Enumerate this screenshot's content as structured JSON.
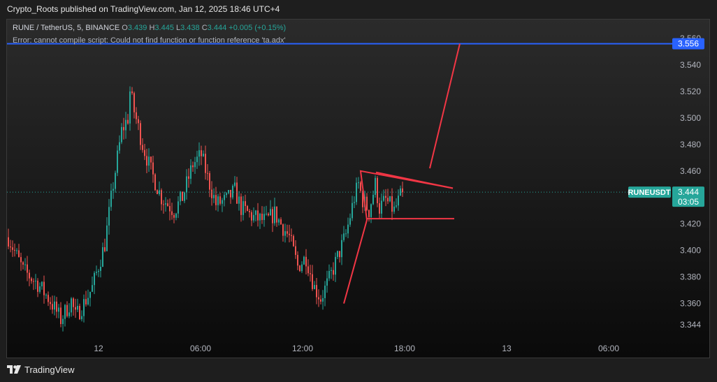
{
  "header": {
    "published": "Crypto_Roots published on TradingView.com, Jan 12, 2025 18:46 UTC+4"
  },
  "legend": {
    "symbol": "RUNE / TetherUS, 5, BINANCE",
    "o_label": "O",
    "o": "3.439",
    "h_label": "H",
    "h": "3.445",
    "l_label": "L",
    "l": "3.438",
    "c_label": "C",
    "c": "3.444",
    "change": "+0.005 (+0.15%)"
  },
  "error": "Error: cannot compile script: Could not find function or function reference 'ta.adx'",
  "badges": {
    "top_price": "3.556",
    "ticker": "RUNEUSDT",
    "price": "3.444",
    "countdown": "03:05"
  },
  "footer": {
    "brand": "TradingView",
    "logo_icon": "tradingview-logo-icon"
  },
  "colors": {
    "up": "#26a69a",
    "down": "#ef5350",
    "level_line": "#2962ff",
    "drawing": "#f23645",
    "badge": "#26a69a"
  },
  "chart_data": {
    "type": "candlestick",
    "y_ticks": [
      "3.560",
      "3.540",
      "3.520",
      "3.500",
      "3.480",
      "3.460",
      "3.420",
      "3.400",
      "3.380",
      "3.360",
      "3.344"
    ],
    "x_ticks": [
      "12",
      "06:00",
      "12:00",
      "18:00",
      "13",
      "06:00"
    ],
    "ylim": [
      3.335,
      3.562
    ],
    "levels": {
      "horizontal_line": 3.556,
      "last_price": 3.444
    },
    "price_path": [
      {
        "t": 0,
        "p": 3.41
      },
      {
        "t": 7,
        "p": 3.385
      },
      {
        "t": 14,
        "p": 3.375
      },
      {
        "t": 20,
        "p": 3.362
      },
      {
        "t": 25,
        "p": 3.348
      },
      {
        "t": 30,
        "p": 3.362
      },
      {
        "t": 32,
        "p": 3.35
      },
      {
        "t": 36,
        "p": 3.36
      },
      {
        "t": 40,
        "p": 3.372
      },
      {
        "t": 46,
        "p": 3.405
      },
      {
        "t": 50,
        "p": 3.45
      },
      {
        "t": 54,
        "p": 3.49
      },
      {
        "t": 57,
        "p": 3.5
      },
      {
        "t": 58,
        "p": 3.52
      },
      {
        "t": 60,
        "p": 3.505
      },
      {
        "t": 64,
        "p": 3.48
      },
      {
        "t": 68,
        "p": 3.46
      },
      {
        "t": 73,
        "p": 3.44
      },
      {
        "t": 79,
        "p": 3.43
      },
      {
        "t": 83,
        "p": 3.44
      },
      {
        "t": 88,
        "p": 3.465
      },
      {
        "t": 92,
        "p": 3.472
      },
      {
        "t": 95,
        "p": 3.455
      },
      {
        "t": 99,
        "p": 3.435
      },
      {
        "t": 104,
        "p": 3.438
      },
      {
        "t": 108,
        "p": 3.445
      },
      {
        "t": 111,
        "p": 3.432
      },
      {
        "t": 117,
        "p": 3.425
      },
      {
        "t": 123,
        "p": 3.422
      },
      {
        "t": 127,
        "p": 3.428
      },
      {
        "t": 130,
        "p": 3.42
      },
      {
        "t": 134,
        "p": 3.41
      },
      {
        "t": 138,
        "p": 3.388
      },
      {
        "t": 142,
        "p": 3.395
      },
      {
        "t": 146,
        "p": 3.372
      },
      {
        "t": 149,
        "p": 3.364
      },
      {
        "t": 153,
        "p": 3.378
      },
      {
        "t": 157,
        "p": 3.395
      },
      {
        "t": 161,
        "p": 3.412
      },
      {
        "t": 165,
        "p": 3.44
      },
      {
        "t": 167,
        "p": 3.45
      },
      {
        "t": 169,
        "p": 3.438
      },
      {
        "t": 172,
        "p": 3.43
      },
      {
        "t": 175,
        "p": 3.45
      },
      {
        "t": 177,
        "p": 3.432
      },
      {
        "t": 180,
        "p": 3.438
      },
      {
        "t": 184,
        "p": 3.43
      },
      {
        "t": 188,
        "p": 3.444
      }
    ]
  }
}
